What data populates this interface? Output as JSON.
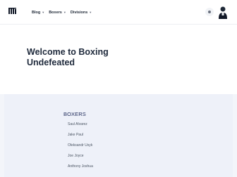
{
  "header": {
    "logo_icon": "stacked-bars-logo",
    "nav": [
      {
        "label": "Blog",
        "icon": "chevron-down-icon"
      },
      {
        "label": "Boxers",
        "icon": "chevron-down-icon"
      },
      {
        "label": "Divisions",
        "icon": "chevron-down-icon"
      }
    ],
    "theme_icon": "sun-icon",
    "avatar_icon": "user-avatar"
  },
  "hero": {
    "title_line1": "Welcome to Boxing",
    "title_line2": "Undefeated"
  },
  "boxers": {
    "heading": "BOXERS",
    "items": [
      "Saul Alvarez",
      "Jake Paul",
      "Oleksandr Usyk",
      "Joe Joyce",
      "Anthony Joshua"
    ]
  },
  "colors": {
    "section_bg": "#eef1f9",
    "heading": "#1e2a5a",
    "text": "#1f2937"
  }
}
